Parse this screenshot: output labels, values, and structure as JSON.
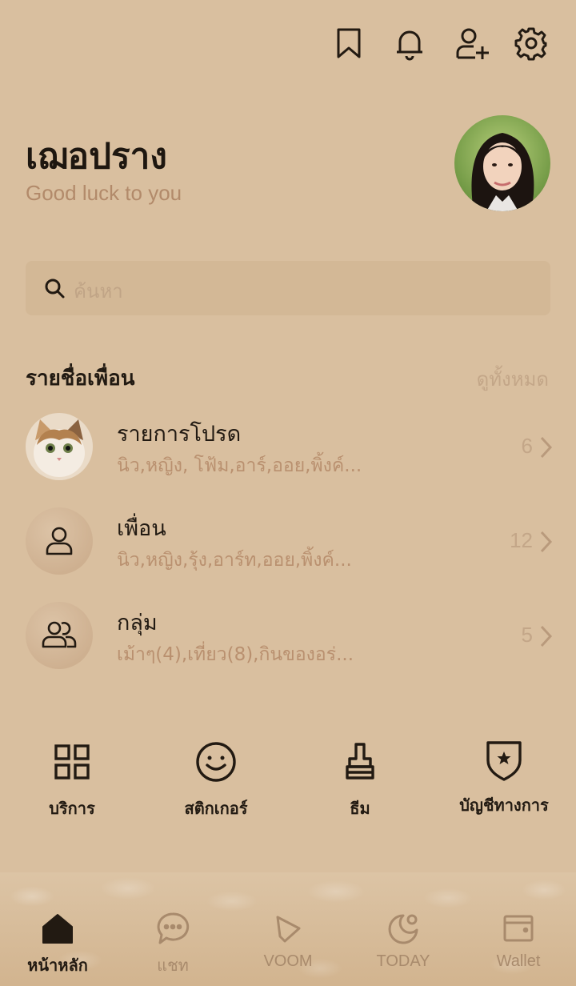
{
  "header": {
    "icons": [
      "bookmark-icon",
      "bell-icon",
      "add-friend-icon",
      "gear-icon"
    ]
  },
  "profile": {
    "name": "เฌอปราง",
    "status": "Good luck to you"
  },
  "search": {
    "placeholder": "ค้นหา"
  },
  "friends_section": {
    "title": "รายชื่อเพื่อน",
    "see_all": "ดูทั้งหมด",
    "rows": [
      {
        "title": "รายการโปรด",
        "subtitle": "นิว,หญิง, โฟ้ม,อาร์,ออย,พิ้งค์...",
        "count": "6"
      },
      {
        "title": "เพื่อน",
        "subtitle": "นิว,หญิง,รุ้ง,อาร์ท,ออย,พิ้งค์...",
        "count": "12"
      },
      {
        "title": "กลุ่ม",
        "subtitle": "เม้าๆ(4),เที่ยว(8),กินของอร่...",
        "count": "5"
      }
    ]
  },
  "services": [
    {
      "label": "บริการ",
      "icon": "grid-icon"
    },
    {
      "label": "สติกเกอร์",
      "icon": "smiley-icon"
    },
    {
      "label": "ธีม",
      "icon": "brush-icon"
    },
    {
      "label": "บัญชีทางการ",
      "icon": "shield-star-icon"
    }
  ],
  "tabbar": {
    "active": 0,
    "items": [
      {
        "label": "หน้าหลัก",
        "icon": "home-icon"
      },
      {
        "label": "แชท",
        "icon": "chat-icon"
      },
      {
        "label": "VOOM",
        "icon": "voom-icon"
      },
      {
        "label": "TODAY",
        "icon": "today-icon"
      },
      {
        "label": "Wallet",
        "icon": "wallet-icon"
      }
    ]
  },
  "colors": {
    "background": "#d9bf9f",
    "text": "#221a12",
    "muted": "#b9906f",
    "search_bg": "#d3b896"
  }
}
